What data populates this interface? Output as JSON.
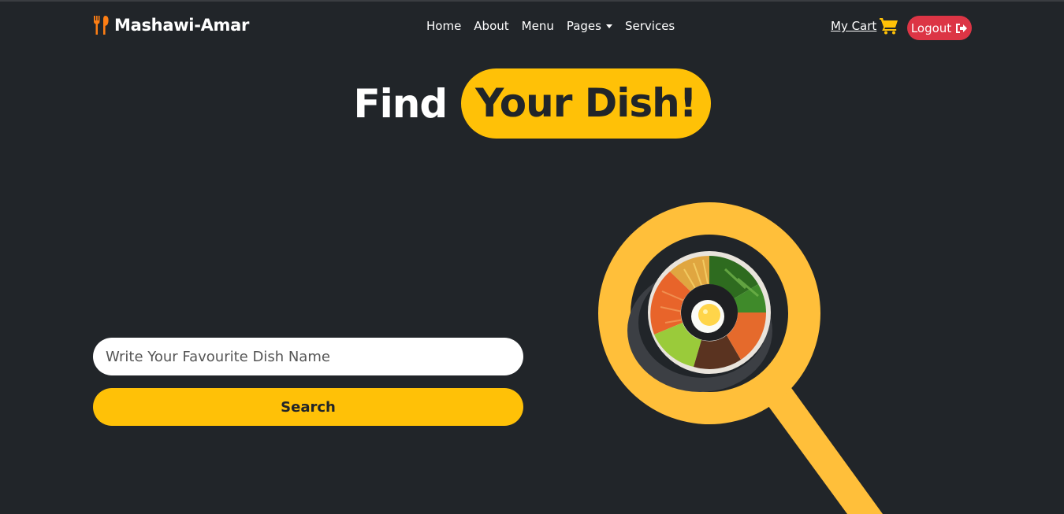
{
  "navbar": {
    "brand_name": "Mashawi-Amar",
    "brand_icon": "utensils-icon",
    "links": [
      {
        "label": "Home"
      },
      {
        "label": "About"
      },
      {
        "label": "Menu"
      },
      {
        "label": "Pages"
      },
      {
        "label": "Services"
      }
    ],
    "cart_label": "My Cart",
    "cart_icon": "cart-icon",
    "logout_label": "Logout",
    "logout_icon": "sign-out-icon"
  },
  "hero": {
    "title_plain": "Find",
    "title_highlight": "Your Dish!"
  },
  "search": {
    "placeholder": "Write Your Favourite Dish Name",
    "value": "",
    "button_label": "Search"
  },
  "colors": {
    "background": "#212529",
    "accent": "#ffc107",
    "logout": "#dc3545",
    "brand_icon": "#fd7e14"
  }
}
